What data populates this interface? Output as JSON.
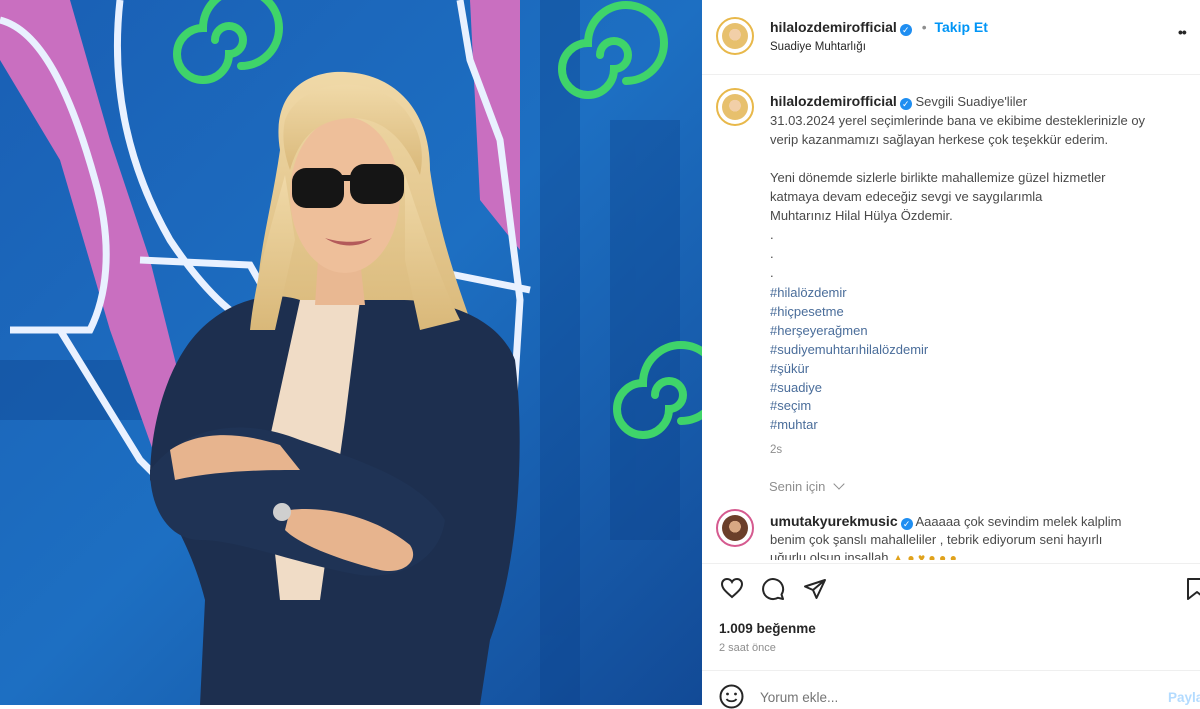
{
  "header": {
    "username": "hilalozdemirofficial",
    "separator": "•",
    "follow_label": "Takip Et",
    "location": "Suadiye Muhtarlığı",
    "more": "••"
  },
  "caption": {
    "username": "hilalozdemirofficial",
    "lines": [
      "Sevgili Suadiye'liler",
      "31.03.2024 yerel seçimlerinde bana ve ekibime desteklerinizle oy",
      "verip kazanmamızı sağlayan herkese çok teşekkür ederim.",
      "Yeni dönemde sizlerle birlikte mahallemize güzel hizmetler",
      "katmaya devam edeceğiz sevgi ve saygılarımla",
      "Muhtarınız Hilal Hülya Özdemir."
    ],
    "dots": [
      ".",
      ".",
      "."
    ],
    "hashtags": [
      "#hilalözdemir",
      "#hiçpesetme",
      "#herşeyerağmen",
      "#sudiyemuhtarıhilalözdemir",
      "#şükür",
      "#suadiye",
      "#seçim",
      "#muhtar"
    ],
    "age": "2s"
  },
  "for_you": "Senin için",
  "comment": {
    "username": "umutakyurekmusic",
    "text_line1": "Aaaaaa çok sevindim melek kalplim",
    "text_line2": "benim çok şanslı mahalleliler , tebrik ediyorum seni hayırlı",
    "text_line3": "uğurlu olsun inşallah"
  },
  "actions": {
    "likes": "1.009 beğenme",
    "time": "2 saat önce"
  },
  "comment_box": {
    "placeholder": "Yorum ekle...",
    "post_label": "Paylaş"
  },
  "colors": {
    "accent": "#0095f6",
    "verified": "#1f8ef1",
    "hashtag": "#4a6d9a"
  }
}
